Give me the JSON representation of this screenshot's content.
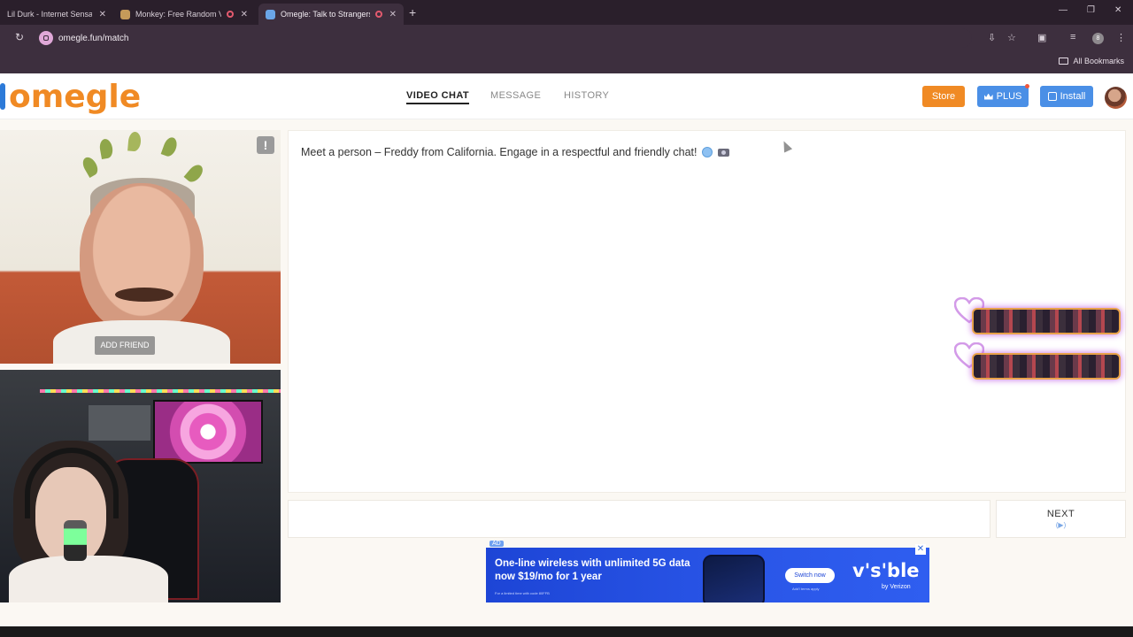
{
  "browser": {
    "tabs": [
      {
        "label": "Lil Durk - Internet Sensation",
        "active": false
      },
      {
        "label": "Monkey: Free Random Vide",
        "active": false
      },
      {
        "label": "Omegle: Talk to Strangers w",
        "active": true
      }
    ],
    "url": "omegle.fun/match",
    "bookmarks_label": "All Bookmarks",
    "profile_initial": "8"
  },
  "site": {
    "logo": "omegle",
    "nav": {
      "video_chat": "VIDEO CHAT",
      "message": "MESSAGE",
      "history": "HISTORY"
    },
    "buttons": {
      "store": "Store",
      "plus": "PLUS",
      "install": "Install"
    }
  },
  "video": {
    "flag_symbol": "!",
    "add_friend": "ADD FRIEND"
  },
  "chat": {
    "intro_message": "Meet a person – Freddy from California. Engage in a respectful and friendly chat!",
    "next_label": "NEXT",
    "next_hint": "(▶)"
  },
  "ad": {
    "tag": "AD",
    "close": "✕",
    "headline": "One-line wireless with unlimited 5G data now $19/mo for 1 year",
    "fine_print": "For a limited time with code 80FFB",
    "cta": "Switch now",
    "cta_sub": "Add'l terms apply",
    "brand": "v's'ble",
    "by": "by Verizon"
  },
  "colors": {
    "accent_orange": "#f08a24",
    "accent_blue": "#4a8fe6",
    "chrome": "#3d2f3e"
  }
}
